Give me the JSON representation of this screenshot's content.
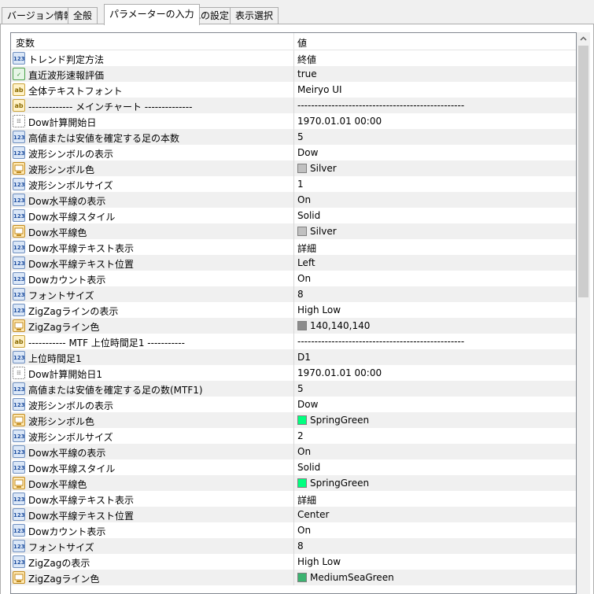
{
  "tabs": [
    {
      "label": "バージョン情報",
      "active": false
    },
    {
      "label": "全般",
      "active": false
    },
    {
      "label": "パラメーターの入力",
      "active": true
    },
    {
      "label": "色の設定",
      "active": false
    },
    {
      "label": "表示選択",
      "active": false
    }
  ],
  "table": {
    "headers": {
      "name": "変数",
      "value": "値"
    },
    "rows": [
      {
        "icon": "123",
        "name": "トレンド判定方法",
        "value": "終値"
      },
      {
        "icon": "bool",
        "name": "直近波形速報評価",
        "value": "true"
      },
      {
        "icon": "ab",
        "name": "全体テキストフォント",
        "value": "Meiryo UI"
      },
      {
        "icon": "ab",
        "name": "------------- メインチャート --------------",
        "value": "-------------------------------------------------"
      },
      {
        "icon": "date",
        "name": "Dow計算開始日",
        "value": "1970.01.01 00:00"
      },
      {
        "icon": "123",
        "name": "高値または安値を確定する足の本数",
        "value": "5"
      },
      {
        "icon": "123",
        "name": "波形シンボルの表示",
        "value": "Dow"
      },
      {
        "icon": "color",
        "name": "波形シンボル色",
        "value": "Silver",
        "swatch": "#c0c0c0"
      },
      {
        "icon": "123",
        "name": "波形シンボルサイズ",
        "value": "1"
      },
      {
        "icon": "123",
        "name": "Dow水平線の表示",
        "value": "On"
      },
      {
        "icon": "123",
        "name": "Dow水平線スタイル",
        "value": "Solid"
      },
      {
        "icon": "color",
        "name": "Dow水平線色",
        "value": "Silver",
        "swatch": "#c0c0c0"
      },
      {
        "icon": "123",
        "name": "Dow水平線テキスト表示",
        "value": "詳細"
      },
      {
        "icon": "123",
        "name": "Dow水平線テキスト位置",
        "value": "Left"
      },
      {
        "icon": "123",
        "name": "Dowカウント表示",
        "value": "On"
      },
      {
        "icon": "123",
        "name": "フォントサイズ",
        "value": "8"
      },
      {
        "icon": "123",
        "name": "ZigZagラインの表示",
        "value": "High Low"
      },
      {
        "icon": "color",
        "name": "ZigZagライン色",
        "value": "140,140,140",
        "swatch": "#8c8c8c"
      },
      {
        "icon": "ab",
        "name": "----------- MTF 上位時間足1 -----------",
        "value": "-------------------------------------------------"
      },
      {
        "icon": "123",
        "name": "上位時間足1",
        "value": "D1"
      },
      {
        "icon": "date",
        "name": "Dow計算開始日1",
        "value": "1970.01.01 00:00"
      },
      {
        "icon": "123",
        "name": "高値または安値を確定する足の数(MTF1)",
        "value": "5"
      },
      {
        "icon": "123",
        "name": "波形シンボルの表示",
        "value": "Dow"
      },
      {
        "icon": "color",
        "name": "波形シンボル色",
        "value": "SpringGreen",
        "swatch": "#00ff7f"
      },
      {
        "icon": "123",
        "name": "波形シンボルサイズ",
        "value": "2"
      },
      {
        "icon": "123",
        "name": "Dow水平線の表示",
        "value": "On"
      },
      {
        "icon": "123",
        "name": "Dow水平線スタイル",
        "value": "Solid"
      },
      {
        "icon": "color",
        "name": "Dow水平線色",
        "value": "SpringGreen",
        "swatch": "#00ff7f"
      },
      {
        "icon": "123",
        "name": "Dow水平線テキスト表示",
        "value": "詳細"
      },
      {
        "icon": "123",
        "name": "Dow水平線テキスト位置",
        "value": "Center"
      },
      {
        "icon": "123",
        "name": "Dowカウント表示",
        "value": "On"
      },
      {
        "icon": "123",
        "name": "フォントサイズ",
        "value": "8"
      },
      {
        "icon": "123",
        "name": "ZigZagの表示",
        "value": "High Low"
      },
      {
        "icon": "color",
        "name": "ZigZagライン色",
        "value": "MediumSeaGreen",
        "swatch": "#3cb371"
      }
    ]
  }
}
